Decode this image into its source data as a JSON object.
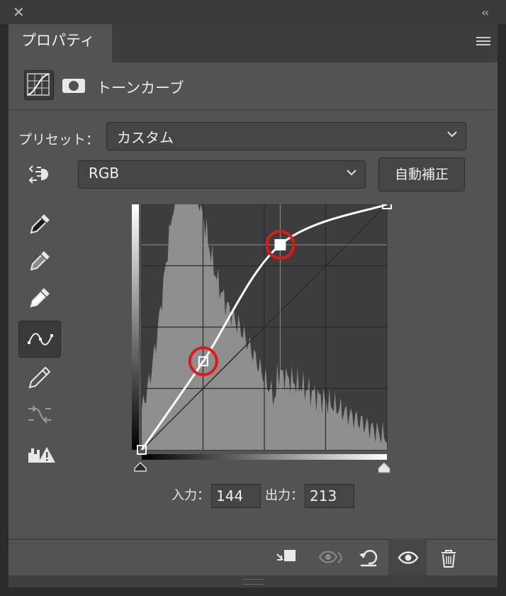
{
  "window": {
    "close_glyph": "✕",
    "collapse_glyph": "‹‹"
  },
  "tabs": [
    {
      "label": "プロパティ",
      "active": true
    }
  ],
  "header": {
    "title": "トーンカーブ",
    "icons": [
      "curves-adjustment-icon",
      "layer-mask-icon"
    ]
  },
  "preset": {
    "label": "プリセット：",
    "value": "カスタム"
  },
  "channel": {
    "value": "RGB"
  },
  "auto_button": {
    "label": "自動補正"
  },
  "tools": [
    "on-image-adjust-icon",
    "black-point-eyedropper-icon",
    "gray-point-eyedropper-icon",
    "white-point-eyedropper-icon",
    "edit-points-curve-icon",
    "pencil-draw-icon",
    "smooth-curve-icon",
    "clipping-warning-icon"
  ],
  "curve": {
    "points": [
      [
        0,
        0
      ],
      [
        64,
        92
      ],
      [
        144,
        213
      ],
      [
        255,
        255
      ]
    ],
    "selected_point": [
      144,
      213
    ],
    "highlight_color": "#e01818"
  },
  "input": {
    "label": "入力：",
    "value": "144"
  },
  "output": {
    "label": "出力：",
    "value": "213"
  },
  "bottom_actions": [
    "clip-to-layer-icon",
    "view-previous-state-icon",
    "reset-icon",
    "visibility-eye-icon",
    "trash-icon"
  ]
}
